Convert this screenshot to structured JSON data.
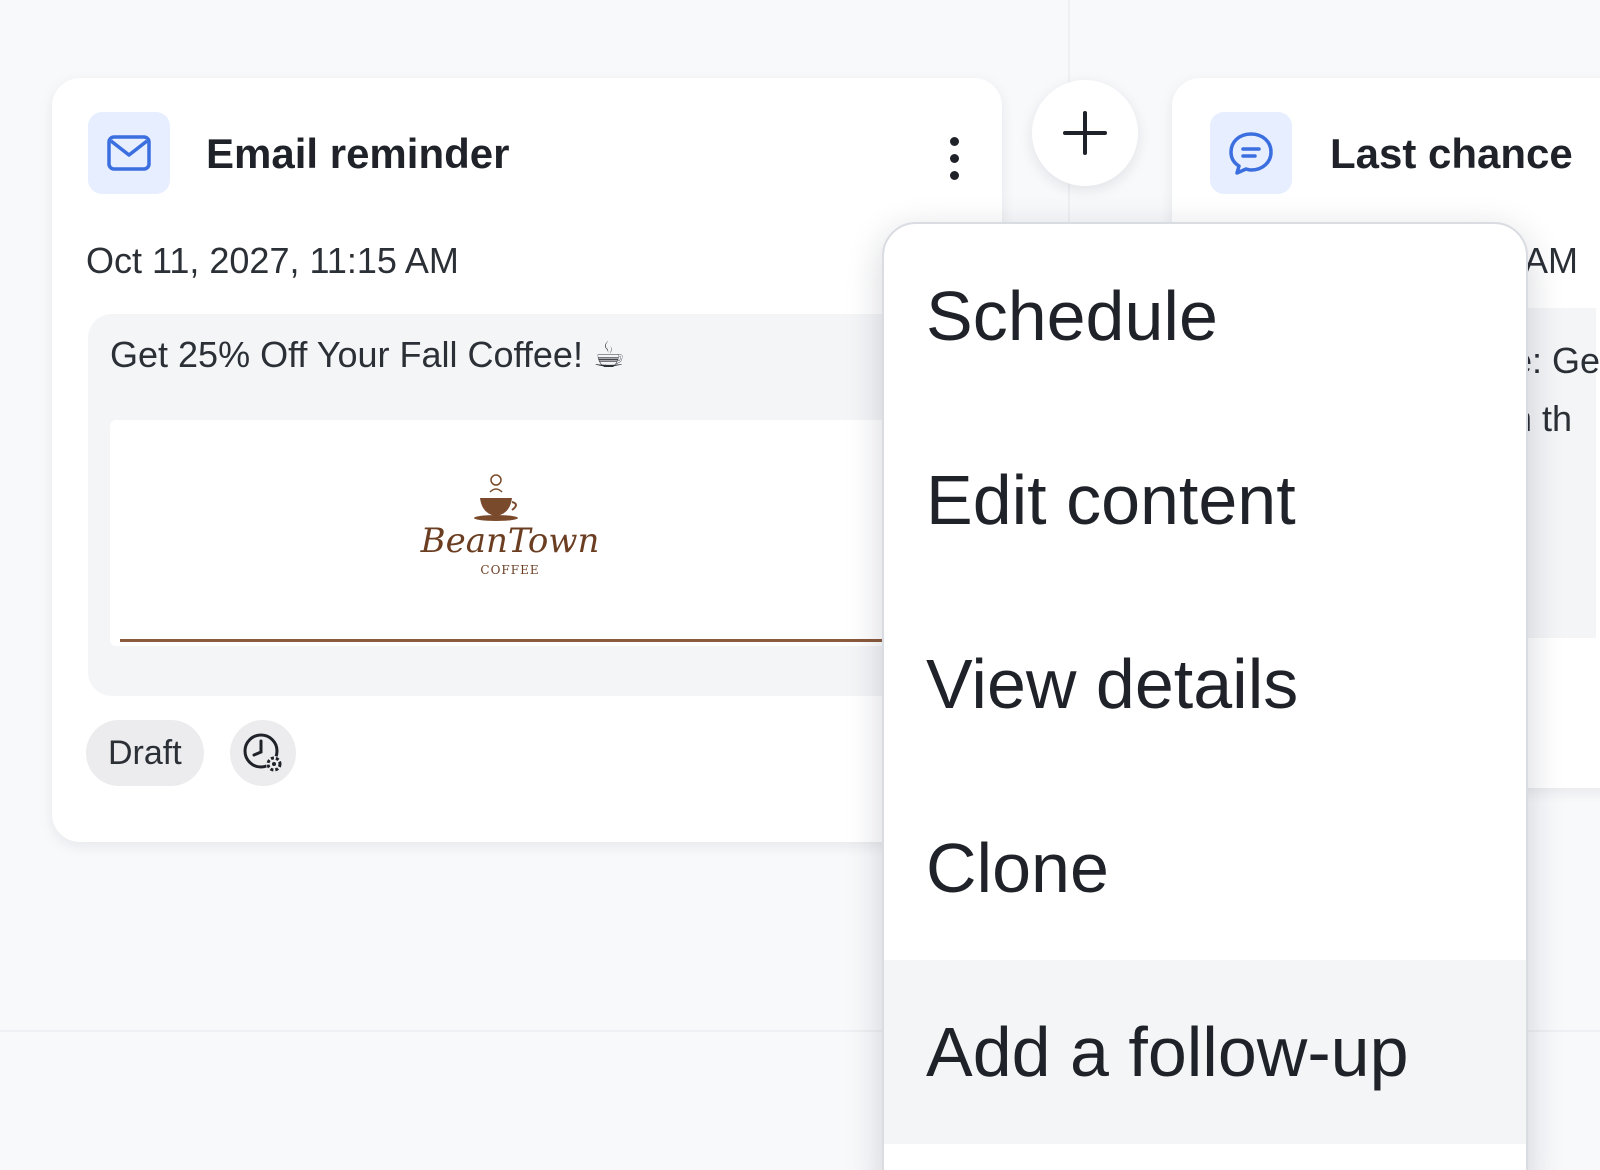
{
  "add_step": {
    "icon": "plus-icon"
  },
  "email_card": {
    "type_icon": "mail-icon",
    "title": "Email reminder",
    "more_icon": "more-vertical-icon",
    "timestamp": "Oct 11, 2027, 11:15 AM",
    "subject": "Get 25% Off Your Fall Coffee! ☕",
    "thumbnail": {
      "brand": "BeanTown",
      "brand_sub": "COFFEE",
      "accent": "#8a5a3c"
    },
    "status_badge": "Draft",
    "schedule_icon": "clock-settings-icon"
  },
  "sms_card": {
    "type_icon": "chat-bubble-icon",
    "title": "Last chance",
    "timestamp_fragment": "5 AM",
    "body_fragment_1": "e: Ge",
    "body_fragment_2": "n th"
  },
  "menu": {
    "items": [
      {
        "label": "Schedule"
      },
      {
        "label": "Edit content"
      },
      {
        "label": "View details"
      },
      {
        "label": "Clone"
      },
      {
        "label": "Add a follow-up"
      }
    ]
  },
  "colors": {
    "accent_blue": "#3b6fe0",
    "tile_bg": "#e6eeff",
    "page_bg": "#f8f9fb"
  }
}
